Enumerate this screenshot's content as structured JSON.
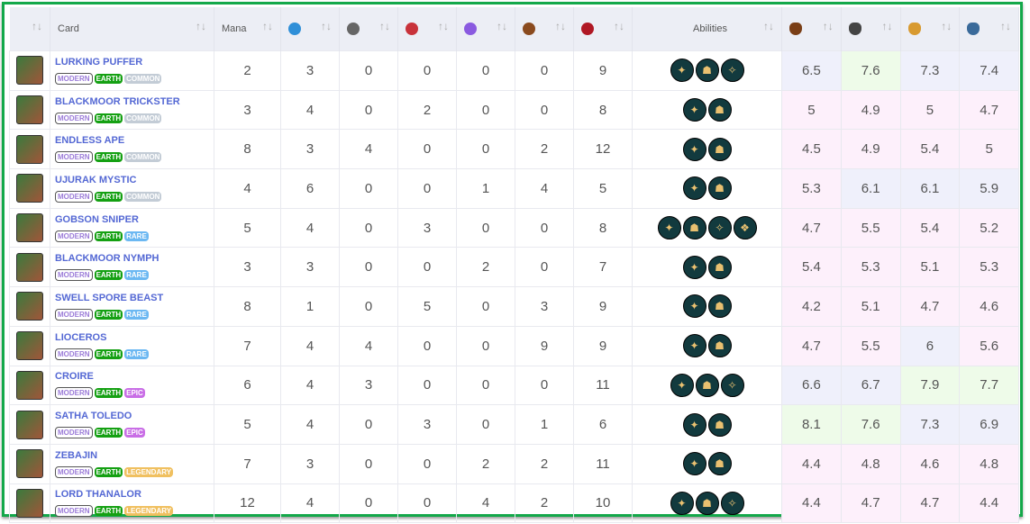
{
  "headers": {
    "card": "Card",
    "mana": "Mana",
    "abilities": "Abilities",
    "sort": "↑↓"
  },
  "stat_icons": [
    "attack-melee-icon",
    "attack-ranged-icon",
    "attack-magic-icon",
    "attack-special-icon",
    "armor-icon",
    "health-icon"
  ],
  "stat_icon_colors": [
    "#2f8fd8",
    "#666",
    "#c8323a",
    "#8a5ae0",
    "#8a4a1e",
    "#b01824"
  ],
  "league_icons": [
    "bronze-league-icon",
    "silver-league-icon",
    "gold-league-icon",
    "diamond-league-icon"
  ],
  "league_icon_colors": [
    "#7a3e16",
    "#444",
    "#d89a30",
    "#3a6a9a"
  ],
  "tags": {
    "edition": "MODERN",
    "element": "EARTH"
  },
  "rows": [
    {
      "name": "LURKING PUFFER",
      "rarity": "COMMON",
      "mana": 2,
      "stats": [
        3,
        0,
        0,
        0,
        0,
        9
      ],
      "abilities": 3,
      "scores": [
        6.5,
        7.6,
        7.3,
        7.4
      ]
    },
    {
      "name": "BLACKMOOR TRICKSTER",
      "rarity": "COMMON",
      "mana": 3,
      "stats": [
        4,
        0,
        2,
        0,
        0,
        8
      ],
      "abilities": 2,
      "scores": [
        5,
        4.9,
        5,
        4.7
      ]
    },
    {
      "name": "ENDLESS APE",
      "rarity": "COMMON",
      "mana": 8,
      "stats": [
        3,
        4,
        0,
        0,
        2,
        12
      ],
      "abilities": 2,
      "scores": [
        4.5,
        4.9,
        5.4,
        5
      ]
    },
    {
      "name": "UJURAK MYSTIC",
      "rarity": "COMMON",
      "mana": 4,
      "stats": [
        6,
        0,
        0,
        1,
        4,
        5
      ],
      "abilities": 2,
      "scores": [
        5.3,
        6.1,
        6.1,
        5.9
      ]
    },
    {
      "name": "GOBSON SNIPER",
      "rarity": "RARE",
      "mana": 5,
      "stats": [
        4,
        0,
        3,
        0,
        0,
        8
      ],
      "abilities": 4,
      "scores": [
        4.7,
        5.5,
        5.4,
        5.2
      ]
    },
    {
      "name": "BLACKMOOR NYMPH",
      "rarity": "RARE",
      "mana": 3,
      "stats": [
        3,
        0,
        0,
        2,
        0,
        7
      ],
      "abilities": 2,
      "scores": [
        5.4,
        5.3,
        5.1,
        5.3
      ]
    },
    {
      "name": "SWELL SPORE BEAST",
      "rarity": "RARE",
      "mana": 8,
      "stats": [
        1,
        0,
        5,
        0,
        3,
        9
      ],
      "abilities": 2,
      "scores": [
        4.2,
        5.1,
        4.7,
        4.6
      ]
    },
    {
      "name": "LIOCEROS",
      "rarity": "RARE",
      "mana": 7,
      "stats": [
        4,
        4,
        0,
        0,
        9,
        9
      ],
      "abilities": 2,
      "scores": [
        4.7,
        5.5,
        6,
        5.6
      ]
    },
    {
      "name": "CROIRE",
      "rarity": "EPIC",
      "mana": 6,
      "stats": [
        4,
        3,
        0,
        0,
        0,
        11
      ],
      "abilities": 3,
      "scores": [
        6.6,
        6.7,
        7.9,
        7.7
      ]
    },
    {
      "name": "SATHA TOLEDO",
      "rarity": "EPIC",
      "mana": 5,
      "stats": [
        4,
        0,
        3,
        0,
        1,
        6
      ],
      "abilities": 2,
      "scores": [
        8.1,
        7.6,
        7.3,
        6.9
      ]
    },
    {
      "name": "ZEBAJIN",
      "rarity": "LEGENDARY",
      "mana": 7,
      "stats": [
        3,
        0,
        0,
        2,
        2,
        11
      ],
      "abilities": 2,
      "scores": [
        4.4,
        4.8,
        4.6,
        4.8
      ]
    },
    {
      "name": "LORD THANALOR",
      "rarity": "LEGENDARY",
      "mana": 12,
      "stats": [
        4,
        0,
        0,
        4,
        2,
        10
      ],
      "abilities": 3,
      "scores": [
        4.4,
        4.7,
        4.7,
        4.4
      ]
    }
  ]
}
